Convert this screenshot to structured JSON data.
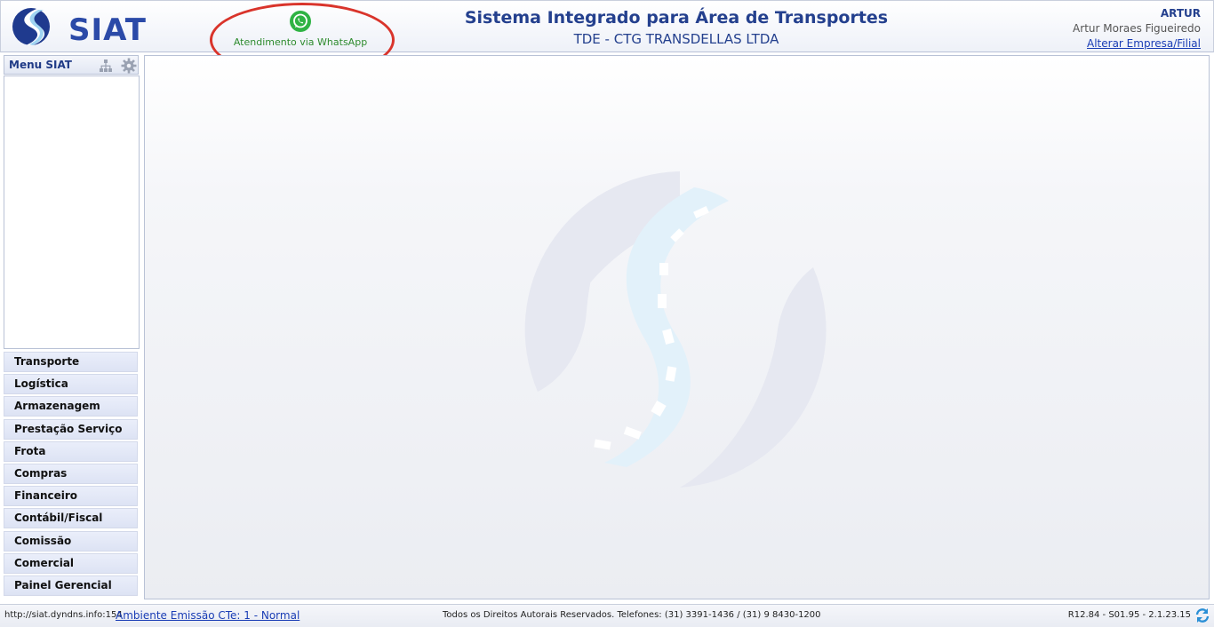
{
  "app": {
    "logo_text": "SIAT",
    "title": "Sistema Integrado para Área de Transportes",
    "company": "TDE - CTG TRANSDELLAS LTDA"
  },
  "whatsapp": {
    "label": "Atendimento via WhatsApp",
    "icon": "whatsapp-icon",
    "color": "#25d366"
  },
  "user": {
    "login": "ARTUR",
    "full_name": "Artur Moraes Figueiredo",
    "change_link": "Alterar Empresa/Filial"
  },
  "sidebar": {
    "title": "Menu SIAT",
    "icons": [
      "tree-icon",
      "gear-icon"
    ],
    "items": [
      {
        "label": "Transporte"
      },
      {
        "label": "Logística"
      },
      {
        "label": "Armazenagem"
      },
      {
        "label": "Prestação Serviço"
      },
      {
        "label": "Frota"
      },
      {
        "label": "Compras"
      },
      {
        "label": "Financeiro"
      },
      {
        "label": "Contábil/Fiscal"
      },
      {
        "label": "Comissão"
      },
      {
        "label": "Comercial"
      },
      {
        "label": "Painel Gerencial"
      }
    ]
  },
  "footer": {
    "url": "http://siat.dyndns.info:154",
    "environment": "Ambiente Emissão CTe: 1 - Normal",
    "rights": "Todos os Direitos Autorais Reservados. Telefones: (31) 3391-1436 / (31) 9 8430-1200",
    "version": "R12.84 - S01.95 - 2.1.23.15"
  },
  "colors": {
    "brand": "#2b4aa8",
    "title": "#24408e",
    "annotation": "#d9342b",
    "link": "#1a3db5"
  }
}
